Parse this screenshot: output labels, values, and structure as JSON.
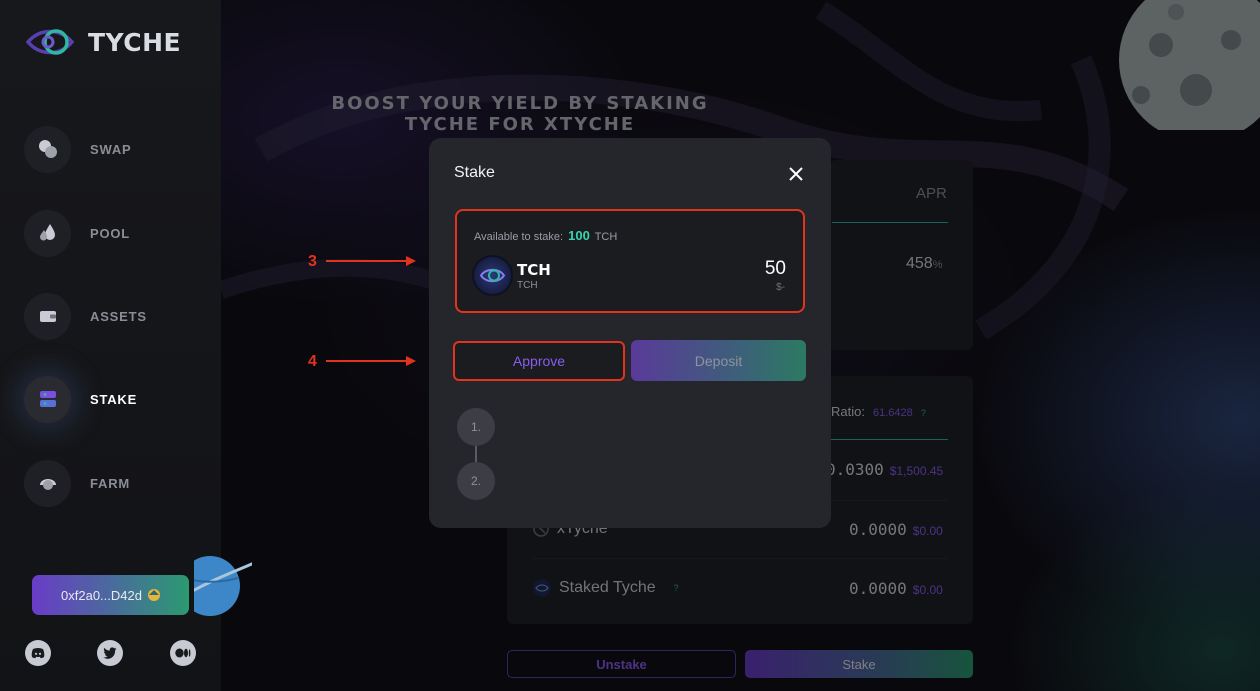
{
  "brand": {
    "name": "TYCHE"
  },
  "sidebar": {
    "items": [
      {
        "label": "SWAP",
        "icon": "swap-icon",
        "active": false
      },
      {
        "label": "POOL",
        "icon": "pool-icon",
        "active": false
      },
      {
        "label": "ASSETS",
        "icon": "wallet-icon",
        "active": false
      },
      {
        "label": "STAKE",
        "icon": "stake-icon",
        "active": true
      },
      {
        "label": "FARM",
        "icon": "farm-icon",
        "active": false
      }
    ],
    "wallet_address": "0xf2a0...D42d",
    "socials": [
      "discord-icon",
      "twitter-icon",
      "medium-icon"
    ]
  },
  "main": {
    "headline_line1": "BOOST YOUR YIELD BY STAKING",
    "headline_line2": "TYCHE FOR XTYCHE",
    "apr_label": "APR",
    "apr_value": "458",
    "apr_unit": "%",
    "ratio_label": "Ratio:",
    "ratio_value": "61.6428",
    "ratio_help": "?",
    "rows": [
      {
        "label": "",
        "amount": "0.0300",
        "usd": "$1,500.45"
      },
      {
        "label": "xTyche",
        "amount": "0.0000",
        "usd": "$0.00"
      },
      {
        "label": "Staked Tyche",
        "amount": "0.0000",
        "usd": "$0.00",
        "help": "?"
      }
    ],
    "unstake_label": "Unstake",
    "stake_label": "Stake"
  },
  "modal": {
    "title": "Stake",
    "available_label": "Available to stake:",
    "available_amount": "100",
    "available_unit": "TCH",
    "token_symbol": "TCH",
    "token_sub": "TCH",
    "amount_value": "50",
    "amount_usd": "$-",
    "approve_label": "Approve",
    "deposit_label": "Deposit",
    "steps": [
      "1.",
      "2."
    ]
  },
  "annotations": {
    "step3": "3",
    "step4": "4"
  },
  "colors": {
    "accent_purple": "#8a5cf0",
    "accent_teal": "#2fb7a4",
    "annotation_red": "#e2331f"
  }
}
